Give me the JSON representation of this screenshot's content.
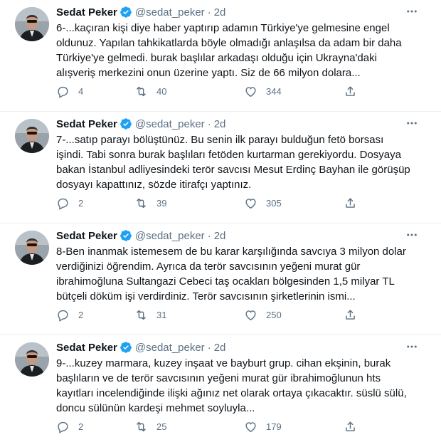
{
  "tweets": [
    {
      "name": "Sedat Peker",
      "handle": "@sedat_peker",
      "separator": "·",
      "time": "2d",
      "text": "6-...kaçıran kişi diye haber yaptırıp adamın Türkiye'ye gelmesine engel oldunuz. Yapılan tahkikatlarda böyle olmadığı anlaşılsa da adam bir daha Türkiye'ye gelmedi. burak başlılar arkadaşı olduğu için Ukrayna'daki alışveriş merkezini onun üzerine yaptı. Siz de 66 milyon dolara...",
      "replies": "4",
      "retweets": "40",
      "likes": "344"
    },
    {
      "name": "Sedat Peker",
      "handle": "@sedat_peker",
      "separator": "·",
      "time": "2d",
      "text": "7-...satıp parayı bölüştünüz. Bu senin ilk parayı bulduğun fetö borsası işindi. Tabi sonra burak başlıları fetöden kurtarman gerekiyordu. Dosyaya bakan İstanbul adliyesindeki terör savcısı Mesut Erdinç Bayhan ile görüşüp dosyayı kapattınız, sözde itirafçı yaptınız.",
      "replies": "2",
      "retweets": "39",
      "likes": "305"
    },
    {
      "name": "Sedat Peker",
      "handle": "@sedat_peker",
      "separator": "·",
      "time": "2d",
      "text": "8-Ben inanmak istemesem de bu karar karşılığında savcıya 3 milyon dolar verdiğinizi öğrendim. Ayrıca da terör savcısının yeğeni murat gür ibrahimoğluna Sultangazi Cebeci taş ocakları bölgesinden 1,5 milyar TL bütçeli döküm işi verdirdiniz. Terör savcısının şirketlerinin ismi...",
      "replies": "2",
      "retweets": "31",
      "likes": "250"
    },
    {
      "name": "Sedat Peker",
      "handle": "@sedat_peker",
      "separator": "·",
      "time": "2d",
      "text": "9-...kuzey marmara, kuzey inşaat ve bayburt grup. cihan ekşinin, burak başlıların ve de terör savcısının yeğeni murat gür ibrahimoğlunun hts kayıtları incelendiğinde ilişki ağınız net olarak ortaya çıkacaktır.  süslü sülü, doncu sülünün kardeşi mehmet soyluyla...",
      "replies": "2",
      "retweets": "25",
      "likes": "179"
    }
  ],
  "icons": {
    "verified": "verified-badge-icon",
    "more": "more-options-icon",
    "reply": "reply-icon",
    "retweet": "retweet-icon",
    "like": "heart-icon",
    "share": "share-icon"
  },
  "colors": {
    "text": "#0f1419",
    "secondary": "#5b7083",
    "verified": "#1da1f2",
    "divider": "#ebeef0"
  }
}
